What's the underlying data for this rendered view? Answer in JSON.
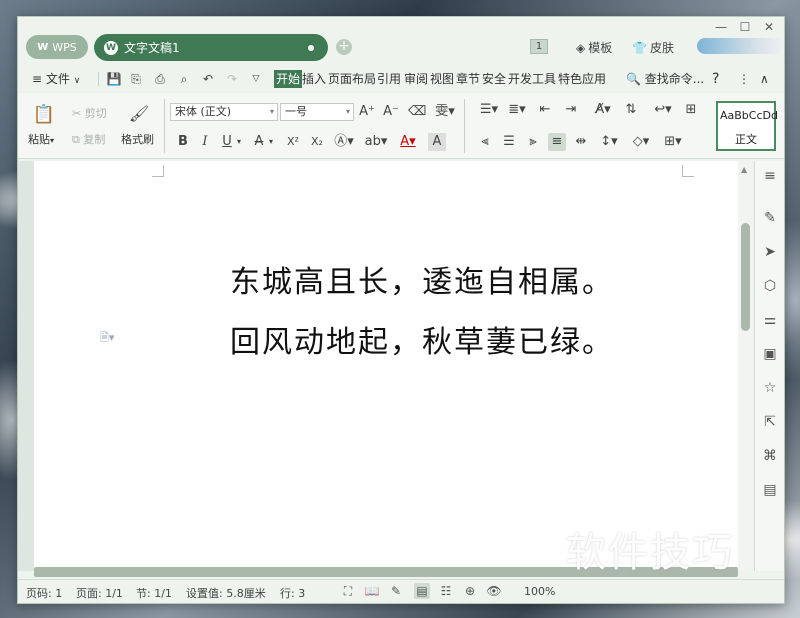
{
  "window": {
    "controls": {
      "minimize": "—",
      "maximize": "☐",
      "close": "✕"
    }
  },
  "tabs": {
    "wps_label": "WPS",
    "doc_label": "文字文稿1",
    "add_label": "+"
  },
  "titlebar": {
    "page_badge": "1",
    "template_label": "模板",
    "skin_label": "皮肤"
  },
  "menubar": {
    "file_label": "文件",
    "items": [
      "开始",
      "插入",
      "页面布局",
      "引用",
      "审阅",
      "视图",
      "章节",
      "安全",
      "开发工具",
      "特色应用"
    ],
    "search_label": "查找命令...",
    "help_label": "?",
    "more_label": "⋮",
    "collapse_label": "∧"
  },
  "ribbon": {
    "paste_label": "粘贴",
    "cut_label": "剪切",
    "copy_label": "复制",
    "format_painter_label": "格式刷",
    "font_name": "宋体 (正文)",
    "font_size": "一号",
    "style_preview": "AaBbCcDd",
    "style_name": "正文",
    "bold": "B",
    "italic": "I",
    "underline": "U",
    "strikethrough": "A",
    "superscript": "X²",
    "subscript": "X₂"
  },
  "document": {
    "lines": [
      "东城高且长，逶迤自相属。",
      "回风动地起，秋草萋已绿。"
    ]
  },
  "statusbar": {
    "page_num": "页码: 1",
    "page_count": "页面: 1/1",
    "section": "节: 1/1",
    "setting": "设置值: 5.8厘米",
    "row": "行: 3",
    "zoom": "100%"
  },
  "watermark": "软件技巧",
  "colors": {
    "accent": "#3f7a55",
    "window_bg": "#eef3ee",
    "scroll": "#aab8ac"
  }
}
